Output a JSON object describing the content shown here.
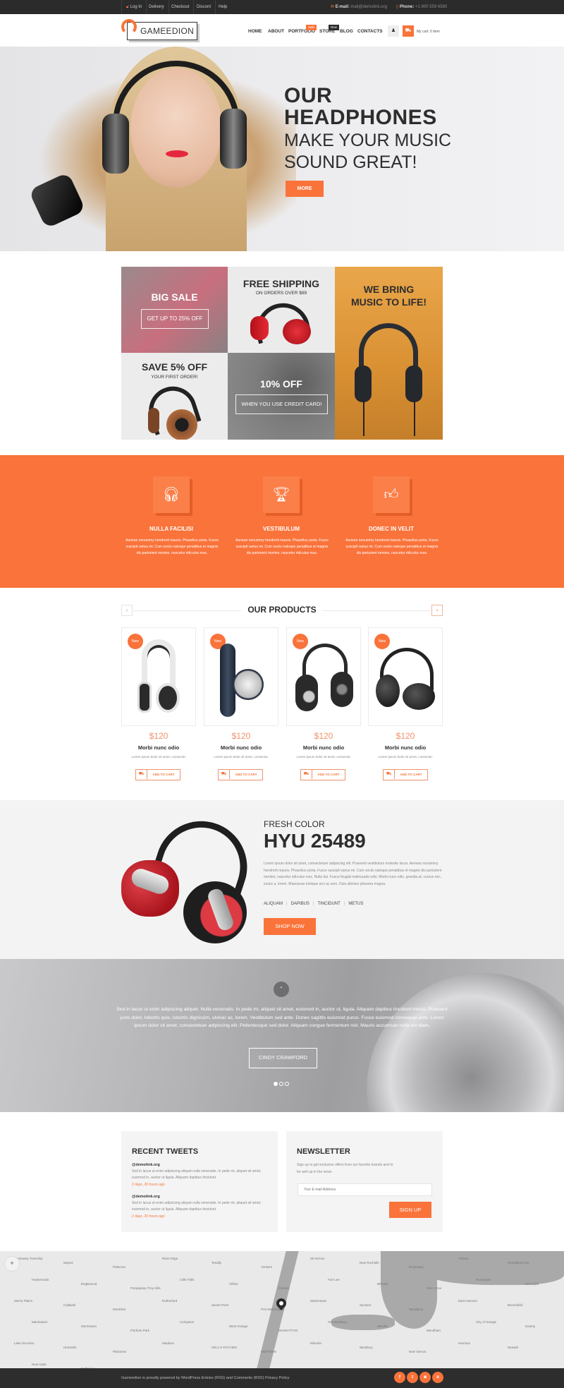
{
  "topbar": {
    "links": [
      "Log In",
      "Delivery",
      "Checkout",
      "Discont",
      "Help"
    ],
    "email_label": "E-mail:",
    "email_value": "mail@demolink.org",
    "phone_label": "Phone:",
    "phone_value": "+1 800 559 6580"
  },
  "header": {
    "logo_text": "GAMEEDION",
    "nav": [
      {
        "label": "HOME"
      },
      {
        "label": "ABOUT"
      },
      {
        "label": "PORTFOLIO",
        "badge": "Sale"
      },
      {
        "label": "STORE",
        "badge": "New"
      },
      {
        "label": "BLOG"
      },
      {
        "label": "CONTACTS"
      }
    ],
    "cart_text": "My cart: 0 item",
    "user_icon": "user-icon",
    "cart_icon": "cart-icon"
  },
  "hero": {
    "title_line1": "OUR",
    "title_line2": "HEADPHONES",
    "subtitle_line1": "MAKE YOUR MUSIC",
    "subtitle_line2": "SOUND GREAT!",
    "button": "MORE"
  },
  "banners": {
    "big_sale": {
      "title": "BIG SALE",
      "box": "GET UP TO 25% OFF"
    },
    "free_shipping": {
      "title": "FREE SHIPPING",
      "sub": "ON ORDERS OVER $99"
    },
    "we_bring": {
      "title_line1": "WE BRING",
      "title_line2": "MUSIC TO LIFE!"
    },
    "save": {
      "title": "SAVE 5% OFF",
      "sub": "YOUR FIRST ORDER!"
    },
    "ten_off": {
      "title": "10% OFF",
      "box": "WHEN YOU USE CREDIT CARD!"
    }
  },
  "features": [
    {
      "icon": "headphones-icon",
      "title": "NULLA FACILISI",
      "text": "Aenean nonummy hendrerit mauris. Phasellus porta. Fusce suscipit varius mi. Cum sociis natoque penatibus et magnis dis parturient montes, nascetur ridiculus mus."
    },
    {
      "icon": "trophy-icon",
      "title": "VESTIBULUM",
      "text": "Aenean nonummy hendrerit mauris. Phasellus porta. Fusce suscipit varius mi. Cum sociis natoque penatibus et magnis dis parturient montes, nascetur ridiculus mus."
    },
    {
      "icon": "thumbs-up-icon",
      "title": "DONEC IN VELIT",
      "text": "Aenean nonummy hendrerit mauris. Phasellus porta. Fusce suscipit varius mi. Cum sociis natoque penatibus et magnis dis parturient montes, nascetur ridiculus mus."
    }
  ],
  "products": {
    "title": "OUR PRODUCTS",
    "prev": "‹",
    "next": "›",
    "items": [
      {
        "badge": "New",
        "price": "$120",
        "name": "Morbi nunc odio",
        "desc": "Lorem ipsum dolor sit amet, consectec",
        "button": "ADD TO CART"
      },
      {
        "badge": "New",
        "price": "$120",
        "name": "Morbi nunc odio",
        "desc": "Lorem ipsum dolor sit amet, consectec",
        "button": "ADD TO CART"
      },
      {
        "badge": "New",
        "price": "$120",
        "name": "Morbi nunc odio",
        "desc": "Lorem ipsum dolor sit amet, consectec",
        "button": "ADD TO CART"
      },
      {
        "badge": "New",
        "price": "$120",
        "name": "Morbi nunc odio",
        "desc": "Lorem ipsum dolor sit amet, consectec",
        "button": "ADD TO CART"
      }
    ]
  },
  "fresh": {
    "subtitle": "FRESH COLOR",
    "title": "HYU 25489",
    "text": "Lorem ipsum dolor sit amet, consectetuer adipiscing elit. Praesent vestibulum molestie lacus. Aenean nonummy hendrerit mauris. Phasellus porta. Fusce suscipit varius mi. Cum sociis natoque penatibus et magnis dis parturient montes, nascetur ridiculus mus. Nulla dui. Fusce feugiat malesuada odio. Morbi nunc odio, gravida at, cursus nec, luctus a, lorem. Maecenas tristique orci ac sem. Duis ultricies pharetra magna.",
    "tags": [
      "ALIQUAM",
      "DAPIBUS",
      "TINCIDUNT",
      "METUS"
    ],
    "button": "SHOP NOW"
  },
  "testimonial": {
    "quote_mark": "“",
    "text": "Sed in lacus ut enim adipiscing aliquet. Nulla venenatis. In pede mi, aliquet sit amet, euismod in, auctor ut, ligula. Aliquam dapibus tincidunt metus. Praesent justo dolor, lobortis quis, lobortis dignissim, ulvinar ac, lorem. Vestibulum sed ante. Donec sagittis euismod purus. Fusce euismod consequat ante. Lorem ipsum dolor sit amet, consectetuer adipiscing elit. Pellentesque sed dolor. Aliquam congue fermentum nisl. Mauris accumsan nulla vel diam.",
    "author": "CINDY CRAWFORD",
    "active_slide": 1,
    "slides": 3
  },
  "tweets": {
    "title": "RECENT TWEETS",
    "items": [
      {
        "user": "@demolink.org",
        "text": "Sed in lacus ut enim adipiscing aliquet nulla venenatis. In pede mi, aliquet sit amet, euismod in, auctor ut ligula. Aliquam dapibus tincidunt.",
        "time": "2 days, 20 hours ago"
      },
      {
        "user": "@demolink.org",
        "text": "Sed in lacus ut enim adipiscing aliquet nulla venenatis. In pede mi, aliquet sit amet, euismod in, auctor ut ligula. Aliquam dapibus tincidunt.",
        "time": "2 days, 20 hours ago"
      }
    ]
  },
  "newsletter": {
    "title": "NEWSLETTER",
    "text": "Sign up to get exclusive offers from our favorite brands and to be well up in the news.",
    "placeholder": "Your E-mail Address",
    "button": "SIGN UP"
  },
  "map": {
    "labels": [
      "Rockaway Township",
      "Wayne",
      "Paterson",
      "River Edge",
      "Tenafly",
      "Yonkers",
      "Mt Vernon",
      "New Rochelle",
      "Rockaway",
      "Totowa",
      "Woodland Park",
      "Hackensack",
      "Englewood",
      "Parsippany-Troy Hills",
      "Little Falls",
      "Clifton",
      "Passaic",
      "Fort Lee",
      "BRONX",
      "Glen Cove",
      "Huntington",
      "Randolph",
      "Morris Plains",
      "Caldwell",
      "Montclair",
      "Rutherford",
      "Sands Point",
      "Port Washington",
      "Muttontown",
      "Syosset",
      "Woodbury",
      "East Hanover",
      "Bloomfield",
      "Manhasset",
      "Morristown",
      "Florham Park",
      "Livingston",
      "West Orange",
      "MANHATTAN",
      "Old Westbury",
      "Melville",
      "Mendham",
      "City of Orange",
      "Kearny",
      "Lake Success",
      "Hicksville",
      "Plainview",
      "Madison",
      "HELL'S KITCHEN",
      "MIDTOWN",
      "Mineola",
      "Westbury",
      "New Vernon",
      "Harrison",
      "Newark",
      "New Hyde",
      "Bethpage"
    ]
  },
  "footer": {
    "text": "Gameedion is proudly powered by WordPress Entries (RSS) and Comments (RSS) Privacy Policy",
    "social": [
      {
        "icon": "facebook-icon",
        "glyph": "f"
      },
      {
        "icon": "twitter-icon",
        "glyph": "t"
      },
      {
        "icon": "instagram-icon",
        "glyph": "◙"
      },
      {
        "icon": "rss-icon",
        "glyph": "ʀ"
      }
    ]
  },
  "colors": {
    "accent": "#f9733a",
    "dark": "#2b2b2b",
    "light_bg": "#f3f3f3",
    "price": "#f0916a"
  }
}
